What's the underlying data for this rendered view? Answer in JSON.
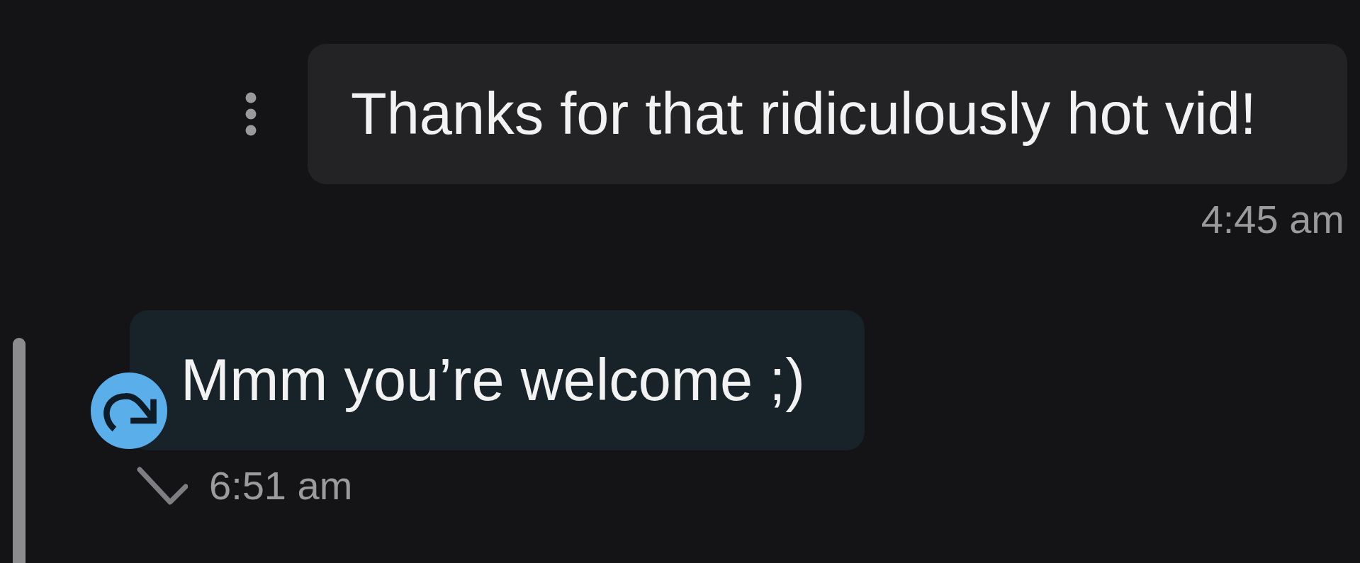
{
  "messages": [
    {
      "kind": "sent",
      "text": "Thanks for that ridiculously hot vid!",
      "time": "4:45 am",
      "delivered": false
    },
    {
      "kind": "received",
      "text": "Mmm you’re welcome ;)",
      "time": "6:51 am",
      "delivered": true
    }
  ]
}
